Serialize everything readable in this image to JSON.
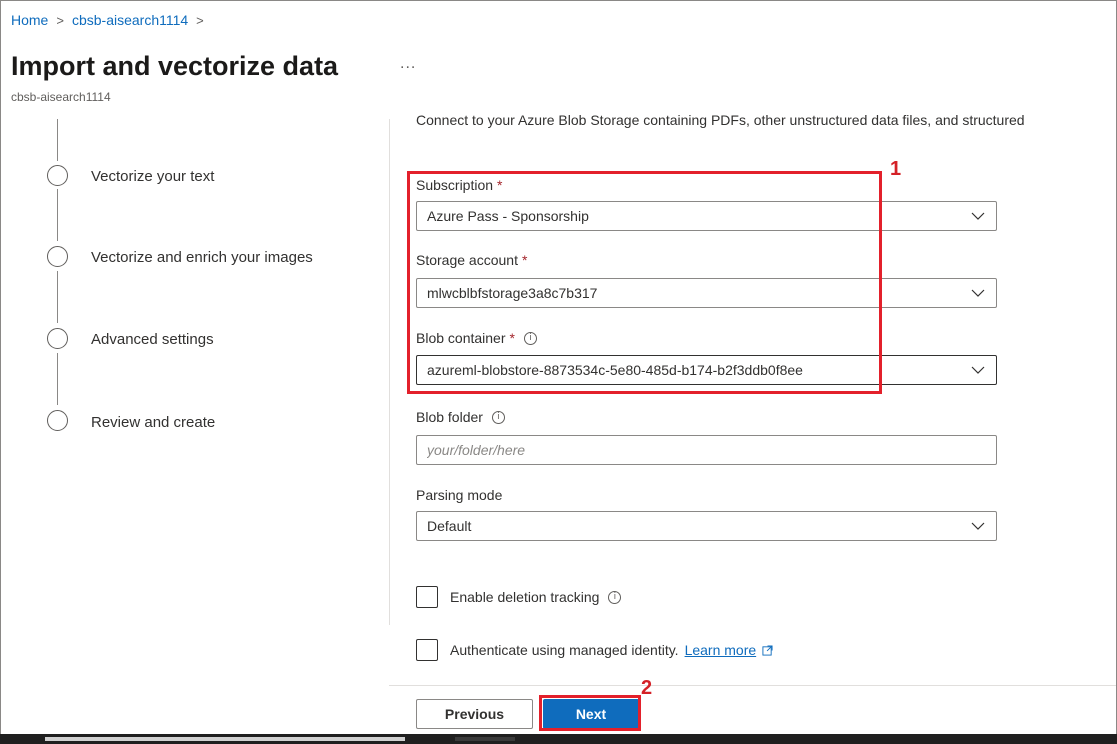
{
  "breadcrumb": {
    "home": "Home",
    "service": "cbsb-aisearch1114"
  },
  "header": {
    "title": "Import and vectorize data",
    "more": "...",
    "subtitle": "cbsb-aisearch1114"
  },
  "steps": [
    {
      "label": "Vectorize your text"
    },
    {
      "label": "Vectorize and enrich your images"
    },
    {
      "label": "Advanced settings"
    },
    {
      "label": "Review and create"
    }
  ],
  "form": {
    "intro": "Connect to your Azure Blob Storage containing PDFs, other unstructured data files, and structured",
    "required_mark": "*",
    "subscription": {
      "label": "Subscription",
      "value": "Azure Pass - Sponsorship"
    },
    "storage_account": {
      "label": "Storage account",
      "value": "mlwcblbfstorage3a8c7b317"
    },
    "blob_container": {
      "label": "Blob container",
      "value": "azureml-blobstore-8873534c-5e80-485d-b174-b2f3ddb0f8ee"
    },
    "blob_folder": {
      "label": "Blob folder",
      "placeholder": "your/folder/here"
    },
    "parsing_mode": {
      "label": "Parsing mode",
      "value": "Default"
    },
    "deletion_tracking": {
      "label": "Enable deletion tracking",
      "checked": false
    },
    "managed_identity": {
      "label": "Authenticate using managed identity.",
      "link": "Learn more",
      "checked": false
    }
  },
  "annotations": {
    "callout_1": "1",
    "callout_2": "2"
  },
  "footer": {
    "previous": "Previous",
    "next": "Next"
  },
  "colors": {
    "accent": "#0f6cbd",
    "highlight": "#e3202b",
    "required": "#a4262c"
  }
}
